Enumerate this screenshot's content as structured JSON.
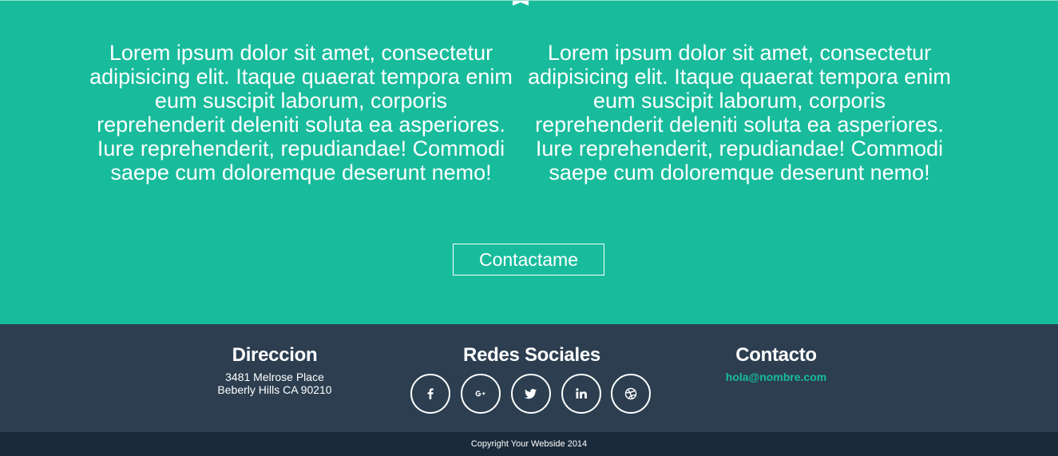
{
  "about": {
    "left_text": "Lorem ipsum dolor sit amet, consectetur adipisicing elit. Itaque quaerat tempora enim eum suscipit laborum, corporis reprehenderit deleniti soluta ea asperiores. Iure reprehenderit, repudiandae! Commodi saepe cum doloremque deserunt nemo!",
    "right_text": "Lorem ipsum dolor sit amet, consectetur adipisicing elit. Itaque quaerat tempora enim eum suscipit laborum, corporis reprehenderit deleniti soluta ea asperiores. Iure reprehenderit, repudiandae! Commodi saepe cum doloremque deserunt nemo!",
    "button_label": "Contactame"
  },
  "footer": {
    "address": {
      "title": "Direccion",
      "line1": "3481 Melrose Place",
      "line2": "Beberly Hills CA 90210"
    },
    "social": {
      "title": "Redes Sociales",
      "icons": [
        "facebook-icon",
        "google-plus-icon",
        "twitter-icon",
        "linkedin-icon",
        "dribbble-icon"
      ]
    },
    "contact": {
      "title": "Contacto",
      "email": "hola@nombre.com"
    }
  },
  "copyright": "Copyright Your Webside 2014",
  "colors": {
    "primary": "#18bc9c",
    "footer": "#2c3e50",
    "copyright_bar": "#1a2a3a"
  }
}
